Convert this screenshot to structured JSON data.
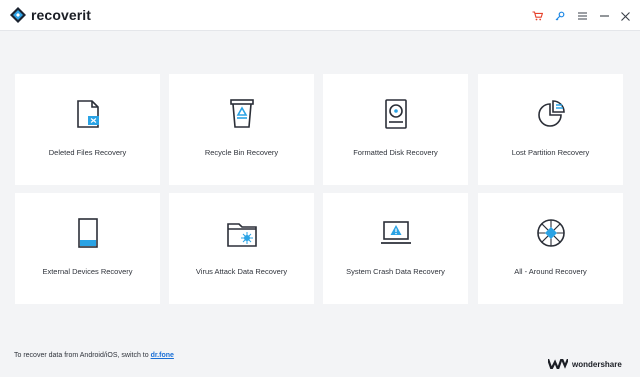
{
  "app": {
    "name_main": "recover",
    "name_suffix": "it"
  },
  "window_controls": {
    "cart_icon": "cart-icon",
    "key_icon": "key-icon",
    "menu_icon": "menu-icon",
    "minimize_icon": "minimize-icon",
    "close_icon": "close-icon",
    "accent_color": "#e6402b",
    "accent_blue": "#1e88e5"
  },
  "cards": [
    {
      "label": "Deleted Files Recovery",
      "icon": "deleted-file-icon"
    },
    {
      "label": "Recycle Bin Recovery",
      "icon": "recycle-bin-icon"
    },
    {
      "label": "Formatted Disk Recovery",
      "icon": "hard-disk-icon"
    },
    {
      "label": "Lost Partition Recovery",
      "icon": "pie-partition-icon"
    },
    {
      "label": "External Devices Recovery",
      "icon": "external-device-icon"
    },
    {
      "label": "Virus Attack Data Recovery",
      "icon": "virus-folder-icon"
    },
    {
      "label": "System Crash Data Recovery",
      "icon": "crashed-laptop-icon"
    },
    {
      "label": "All - Around Recovery",
      "icon": "all-around-icon"
    }
  ],
  "footer": {
    "note_text": "To recover data from Android/iOS, switch to ",
    "link_text": "dr.fone",
    "brand": "wondershare"
  }
}
